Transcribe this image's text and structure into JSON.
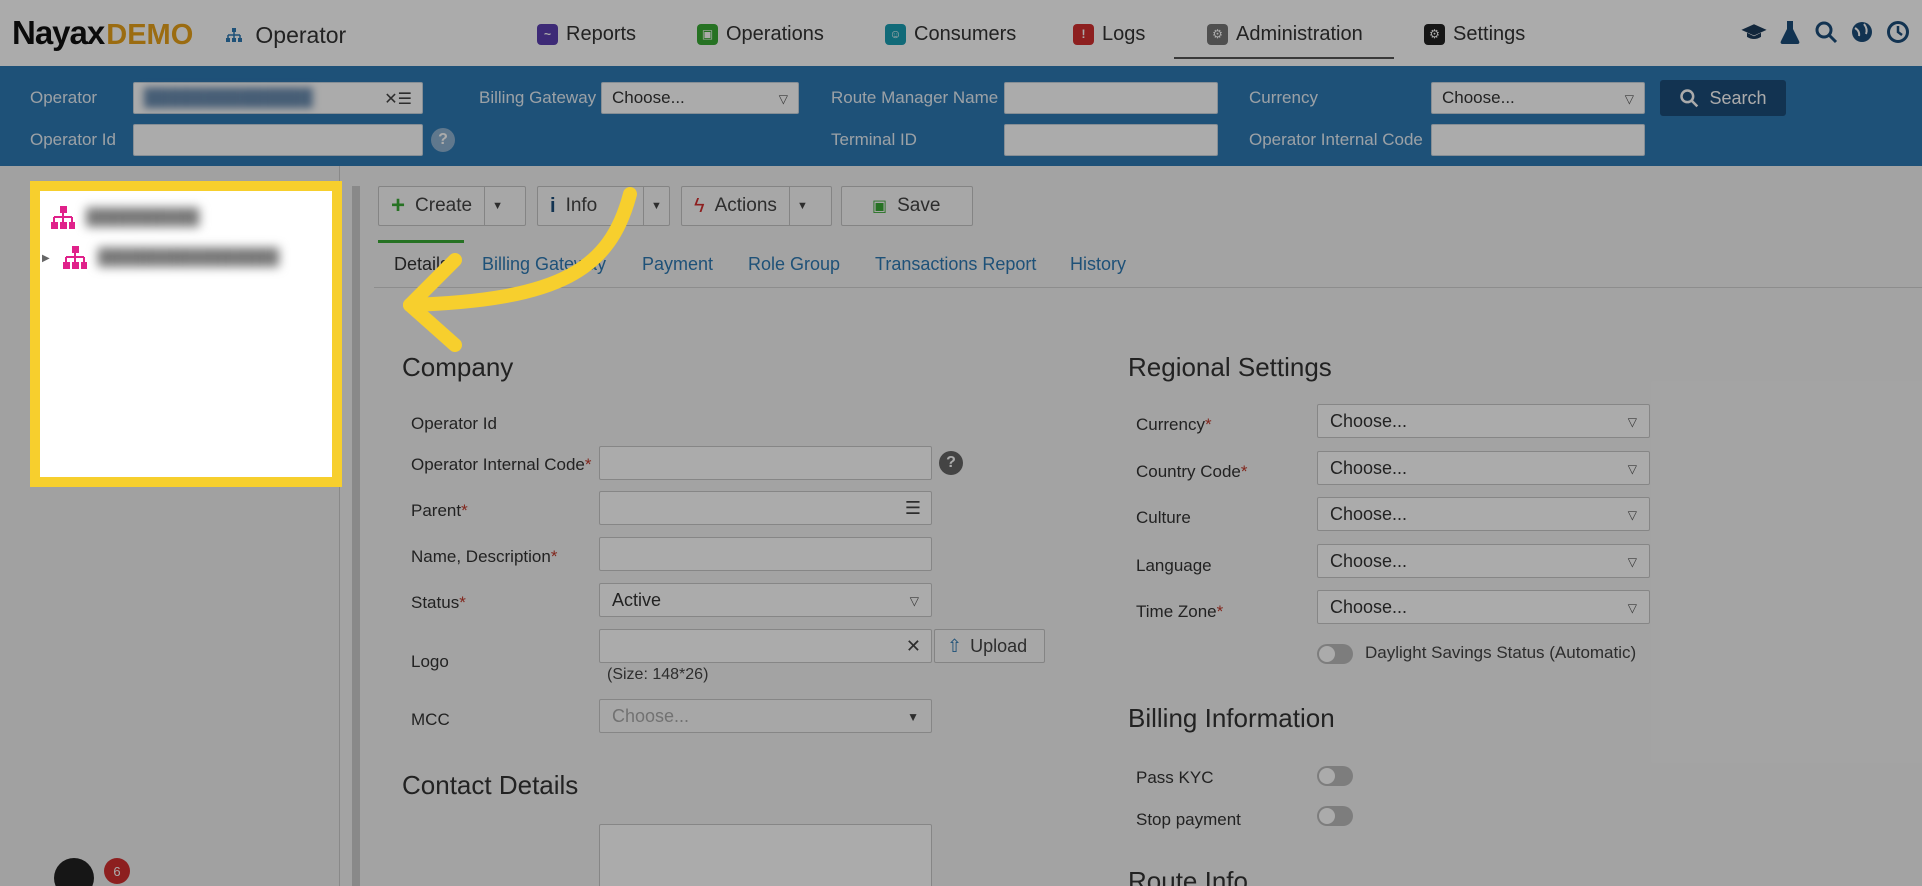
{
  "brand": {
    "name": "Nayax",
    "badge": "DEMO",
    "app": "Operator"
  },
  "nav": {
    "items": [
      {
        "label": "Reports",
        "icon": "reports-icon",
        "color": "#5b3fb0"
      },
      {
        "label": "Operations",
        "icon": "operations-icon",
        "color": "#3aaa35"
      },
      {
        "label": "Consumers",
        "icon": "consumers-icon",
        "color": "#1a9fb3"
      },
      {
        "label": "Logs",
        "icon": "logs-icon",
        "color": "#d32f2f"
      },
      {
        "label": "Administration",
        "icon": "administration-icon",
        "color": "#777777"
      },
      {
        "label": "Settings",
        "icon": "settings-icon",
        "color": "#222222"
      }
    ],
    "active": "Administration"
  },
  "filters": {
    "operator_label": "Operator",
    "operator_id_label": "Operator Id",
    "billing_gateway_label": "Billing Gateway",
    "billing_gateway_value": "Choose...",
    "route_manager_label": "Route Manager Name",
    "terminal_id_label": "Terminal ID",
    "currency_label": "Currency",
    "currency_value": "Choose...",
    "operator_internal_code_label": "Operator Internal Code",
    "search_label": "Search"
  },
  "toolbar": {
    "create": "Create",
    "info": "Info",
    "actions": "Actions",
    "save": "Save"
  },
  "tabs": [
    "Details",
    "Billing Gateway",
    "Payment",
    "Role Group",
    "Transactions Report",
    "History"
  ],
  "company": {
    "title": "Company",
    "operator_id": "Operator Id",
    "operator_internal_code": "Operator Internal Code",
    "parent": "Parent",
    "name_description": "Name, Description",
    "status": "Status",
    "status_value": "Active",
    "logo": "Logo",
    "upload": "Upload",
    "logo_size": "(Size: 148*26)",
    "mcc": "MCC",
    "mcc_value": "Choose...",
    "required_mark": "*"
  },
  "contact": {
    "title": "Contact Details"
  },
  "regional": {
    "title": "Regional Settings",
    "currency": "Currency",
    "country_code": "Country Code",
    "culture": "Culture",
    "language": "Language",
    "time_zone": "Time Zone",
    "choose": "Choose...",
    "dst": "Daylight Savings Status (Automatic)"
  },
  "billing": {
    "title": "Billing Information",
    "pass_kyc": "Pass KYC",
    "stop_payment": "Stop payment"
  },
  "route": {
    "title": "Route Info"
  },
  "notifications": {
    "count": "6"
  },
  "colors": {
    "filterbar": "#2e79b3",
    "highlight": "#f7cf2d",
    "brand_demo": "#e8a21a",
    "tree_icon": "#e0218a"
  }
}
